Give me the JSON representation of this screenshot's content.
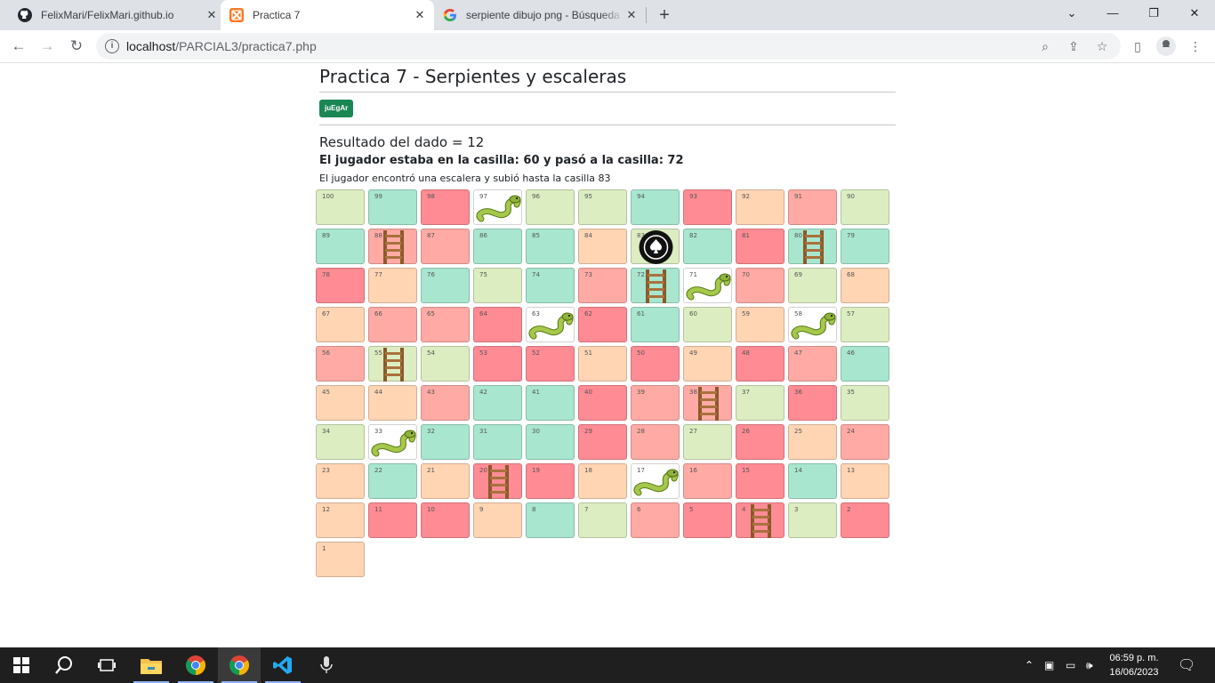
{
  "browser": {
    "tabs": [
      {
        "title": "FelixMari/FelixMari.github.io",
        "icon": "github-icon"
      },
      {
        "title": "Practica 7",
        "icon": "xampp-icon"
      },
      {
        "title": "serpiente dibujo png - Búsqueda",
        "icon": "google-icon"
      }
    ],
    "url": {
      "host": "localhost",
      "path": "/PARCIAL3/practica7.php"
    }
  },
  "page": {
    "title": "Practica 7 - Serpientes y escaleras",
    "play_button": "juEgAr",
    "dice_result": "Resultado del dado = 12",
    "move_text": "El jugador estaba en la casilla: 60 y pasó a la casilla: 72",
    "event_text": "El jugador encontró una escalera y subió hasta la casilla 83"
  },
  "board": {
    "cells": [
      {
        "n": "100",
        "c": "lime"
      },
      {
        "n": "99",
        "c": "mint"
      },
      {
        "n": "98",
        "c": "red"
      },
      {
        "n": "97",
        "c": "white",
        "pic": "snake"
      },
      {
        "n": "96",
        "c": "lime"
      },
      {
        "n": "95",
        "c": "lime"
      },
      {
        "n": "94",
        "c": "mint"
      },
      {
        "n": "93",
        "c": "red"
      },
      {
        "n": "92",
        "c": "peach"
      },
      {
        "n": "91",
        "c": "salmon"
      },
      {
        "n": "90",
        "c": "lime"
      },
      {
        "n": "89",
        "c": "mint"
      },
      {
        "n": "88",
        "c": "salmon",
        "pic": "ladder"
      },
      {
        "n": "87",
        "c": "salmon"
      },
      {
        "n": "86",
        "c": "mint"
      },
      {
        "n": "85",
        "c": "mint"
      },
      {
        "n": "84",
        "c": "peach"
      },
      {
        "n": "83",
        "c": "lime",
        "pic": "player"
      },
      {
        "n": "82",
        "c": "mint"
      },
      {
        "n": "81",
        "c": "red"
      },
      {
        "n": "80",
        "c": "mint",
        "pic": "ladder"
      },
      {
        "n": "79",
        "c": "mint"
      },
      {
        "n": "78",
        "c": "red"
      },
      {
        "n": "77",
        "c": "peach"
      },
      {
        "n": "76",
        "c": "mint"
      },
      {
        "n": "75",
        "c": "lime"
      },
      {
        "n": "74",
        "c": "mint"
      },
      {
        "n": "73",
        "c": "salmon"
      },
      {
        "n": "72",
        "c": "mint",
        "pic": "ladder"
      },
      {
        "n": "71",
        "c": "white",
        "pic": "snake"
      },
      {
        "n": "70",
        "c": "salmon"
      },
      {
        "n": "69",
        "c": "lime"
      },
      {
        "n": "68",
        "c": "peach"
      },
      {
        "n": "67",
        "c": "peach"
      },
      {
        "n": "66",
        "c": "salmon"
      },
      {
        "n": "65",
        "c": "salmon"
      },
      {
        "n": "64",
        "c": "red"
      },
      {
        "n": "63",
        "c": "white",
        "pic": "snake"
      },
      {
        "n": "62",
        "c": "red"
      },
      {
        "n": "61",
        "c": "mint"
      },
      {
        "n": "60",
        "c": "lime"
      },
      {
        "n": "59",
        "c": "peach"
      },
      {
        "n": "58",
        "c": "white",
        "pic": "snake"
      },
      {
        "n": "57",
        "c": "lime"
      },
      {
        "n": "56",
        "c": "salmon"
      },
      {
        "n": "55",
        "c": "lime",
        "pic": "ladder"
      },
      {
        "n": "54",
        "c": "lime"
      },
      {
        "n": "53",
        "c": "red"
      },
      {
        "n": "52",
        "c": "red"
      },
      {
        "n": "51",
        "c": "peach"
      },
      {
        "n": "50",
        "c": "red"
      },
      {
        "n": "49",
        "c": "peach"
      },
      {
        "n": "48",
        "c": "red"
      },
      {
        "n": "47",
        "c": "salmon"
      },
      {
        "n": "46",
        "c": "mint"
      },
      {
        "n": "45",
        "c": "peach"
      },
      {
        "n": "44",
        "c": "peach"
      },
      {
        "n": "43",
        "c": "salmon"
      },
      {
        "n": "42",
        "c": "mint"
      },
      {
        "n": "41",
        "c": "mint"
      },
      {
        "n": "40",
        "c": "red"
      },
      {
        "n": "39",
        "c": "salmon"
      },
      {
        "n": "38",
        "c": "salmon",
        "pic": "ladder"
      },
      {
        "n": "37",
        "c": "lime"
      },
      {
        "n": "36",
        "c": "red"
      },
      {
        "n": "35",
        "c": "lime"
      },
      {
        "n": "34",
        "c": "lime"
      },
      {
        "n": "33",
        "c": "white",
        "pic": "snake"
      },
      {
        "n": "32",
        "c": "mint"
      },
      {
        "n": "31",
        "c": "mint"
      },
      {
        "n": "30",
        "c": "mint"
      },
      {
        "n": "29",
        "c": "red"
      },
      {
        "n": "28",
        "c": "salmon"
      },
      {
        "n": "27",
        "c": "lime"
      },
      {
        "n": "26",
        "c": "red"
      },
      {
        "n": "25",
        "c": "peach"
      },
      {
        "n": "24",
        "c": "salmon"
      },
      {
        "n": "23",
        "c": "peach"
      },
      {
        "n": "22",
        "c": "mint"
      },
      {
        "n": "21",
        "c": "peach"
      },
      {
        "n": "20",
        "c": "red",
        "pic": "ladder"
      },
      {
        "n": "19",
        "c": "red"
      },
      {
        "n": "18",
        "c": "peach"
      },
      {
        "n": "17",
        "c": "white",
        "pic": "snake"
      },
      {
        "n": "16",
        "c": "salmon"
      },
      {
        "n": "15",
        "c": "red"
      },
      {
        "n": "14",
        "c": "mint"
      },
      {
        "n": "13",
        "c": "peach"
      },
      {
        "n": "12",
        "c": "peach"
      },
      {
        "n": "11",
        "c": "red"
      },
      {
        "n": "10",
        "c": "red"
      },
      {
        "n": "9",
        "c": "peach"
      },
      {
        "n": "8",
        "c": "mint"
      },
      {
        "n": "7",
        "c": "lime"
      },
      {
        "n": "6",
        "c": "salmon"
      },
      {
        "n": "5",
        "c": "red"
      },
      {
        "n": "4",
        "c": "red",
        "pic": "ladder"
      },
      {
        "n": "3",
        "c": "lime"
      },
      {
        "n": "2",
        "c": "red"
      },
      {
        "n": "1",
        "c": "peach"
      }
    ]
  },
  "colors": {
    "peach": "#ffd5b4",
    "mint": "#a8e6cf",
    "red": "#ff8b94",
    "salmon": "#ffaaa5",
    "lime": "#dcedc1",
    "button": "#198754"
  },
  "taskbar": {
    "items": [
      "windows-start-icon",
      "search-icon",
      "task-view-icon",
      "file-explorer-icon",
      "chrome-icon",
      "chrome-icon",
      "vscode-icon",
      "voice-recorder-icon"
    ],
    "time": "06:59 p. m.",
    "date": "16/06/2023"
  }
}
